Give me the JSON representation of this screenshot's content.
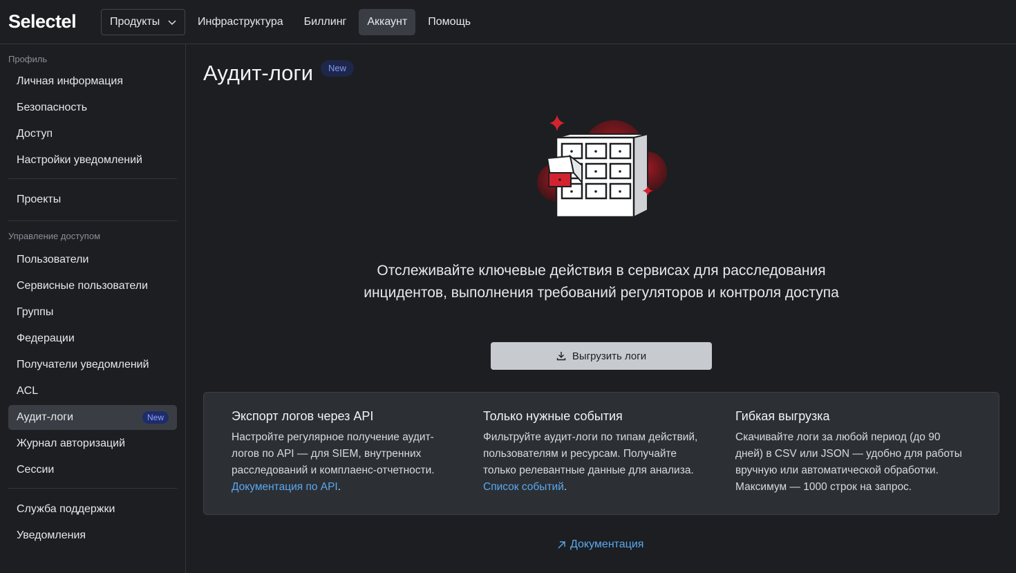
{
  "header": {
    "logo": "Selectel",
    "products_label": "Продукты",
    "nav": [
      "Инфраструктура",
      "Биллинг",
      "Аккаунт",
      "Помощь"
    ],
    "active_nav": "Аккаунт"
  },
  "sidebar": {
    "profile_section": "Профиль",
    "profile_items": [
      "Личная информация",
      "Безопасность",
      "Доступ",
      "Настройки уведомлений"
    ],
    "projects": "Проекты",
    "access_section": "Управление доступом",
    "access_items": [
      "Пользователи",
      "Сервисные пользователи",
      "Группы",
      "Федерации",
      "Получатели уведомлений",
      "ACL",
      "Аудит-логи",
      "Журнал авторизаций",
      "Сессии"
    ],
    "active_item": "Аудит-логи",
    "new_badge": "New",
    "bottom_items": [
      "Служба поддержки",
      "Уведомления"
    ]
  },
  "main": {
    "title": "Аудит-логи",
    "title_badge": "New",
    "lead_text": "Отслеживайте ключевые действия в сервисах для расследования инцидентов, выполнения требований регуляторов и контроля доступа",
    "export_button": "Выгрузить логи",
    "features": [
      {
        "title": "Экспорт логов через API",
        "text": "Настройте регулярное получение аудит-логов по API — для SIEM, внутренних расследований и комплаенс-отчетности.",
        "link": "Документация по API",
        "suffix": "."
      },
      {
        "title": "Только нужные события",
        "text": "Фильтруйте аудит-логи по типам действий, пользователям и ресурсам. Получайте только релевантные данные для анализа.",
        "link": "Список событий",
        "suffix": "."
      },
      {
        "title": "Гибкая выгрузка",
        "text": "Скачивайте логи за любой период (до 90 дней) в CSV или JSON — удобно для работы вручную или автоматической обработки. Максимум — 1000 строк на запрос."
      }
    ],
    "doc_link": "Документация"
  },
  "colors": {
    "background": "#1c1e21",
    "accent_red": "#d3232f",
    "link_blue": "#5aa9f0",
    "badge_blue": "#7f98ff"
  }
}
